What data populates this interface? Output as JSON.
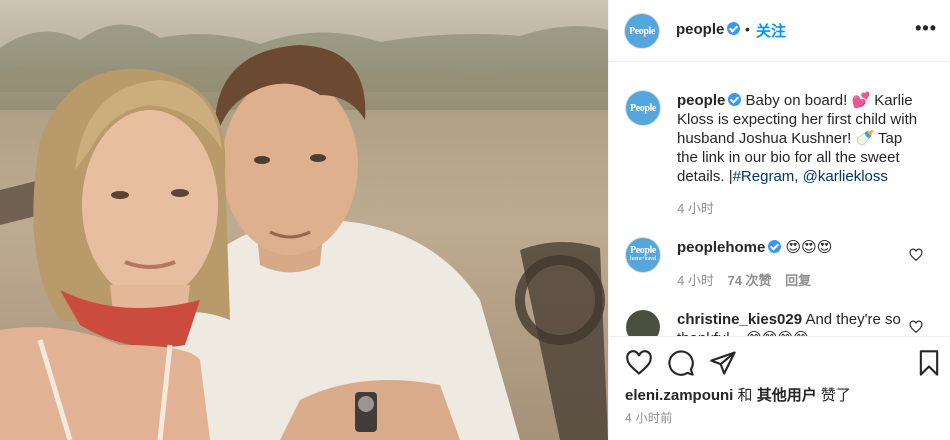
{
  "post": {
    "photo_alt": "Photo of a smiling couple outdoors on safari at sunset",
    "author": {
      "username": "people",
      "avatar_text": "People",
      "verified": true,
      "follow_label": "关注"
    },
    "caption": {
      "username": "people",
      "text_1": "Baby on board! ",
      "emoji_1": "💕",
      "text_2": " Karlie Kloss is expecting her first child with husband Joshua Kushner! ",
      "emoji_2": "🍼",
      "text_3": " Tap the link in our bio for all the sweet details. |",
      "hashtag": "#Regram",
      "separator": ", ",
      "mention": "@karliekloss",
      "time": "4 小时"
    },
    "comments": [
      {
        "username": "peoplehome",
        "avatar_text": "People",
        "avatar_sub": "home+travel",
        "verified": true,
        "text": "😍😍😍",
        "time": "4 小时",
        "likes": "74 次赞",
        "reply_label": "回复"
      },
      {
        "username": "christine_kies029",
        "text": "And they're",
        "text_cont": "so thankful... 😊😊😊😊"
      }
    ],
    "liked_by": {
      "user": "eleni.zampouni",
      "connector": " 和 ",
      "others": "其他用户",
      "suffix": " 赞了"
    },
    "timestamp": "4 小时前"
  },
  "icons": {
    "more": "more-options-icon",
    "like": "heart-outline-icon",
    "comment": "comment-bubble-icon",
    "share": "paper-plane-icon",
    "save": "bookmark-icon"
  },
  "colors": {
    "brand_blue": "#54a6dc",
    "follow_blue": "#0095f6",
    "link_blue": "#00376b",
    "verified_blue": "#3897f0",
    "muted_gray": "#8e8e8e"
  }
}
